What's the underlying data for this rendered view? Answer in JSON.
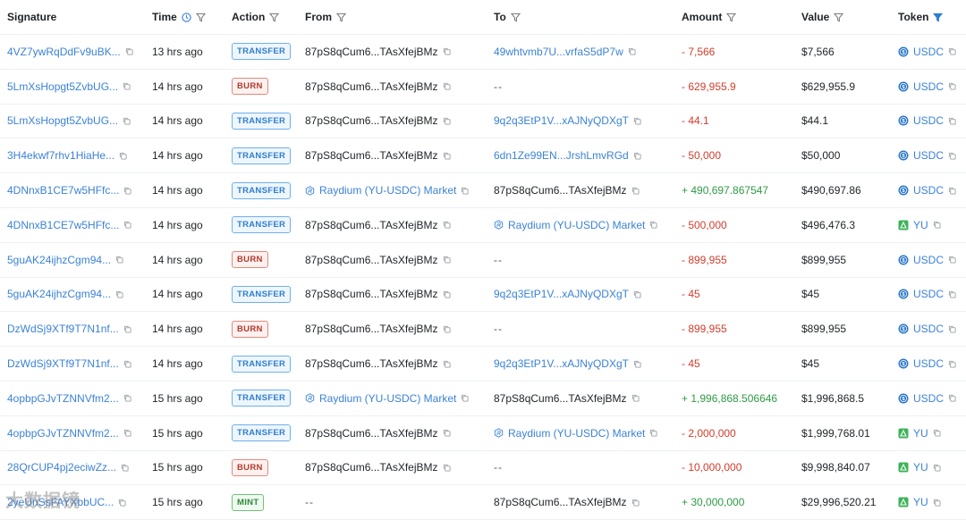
{
  "columns": {
    "signature": "Signature",
    "time": "Time",
    "action": "Action",
    "from": "From",
    "to": "To",
    "amount": "Amount",
    "value": "Value",
    "token": "Token"
  },
  "colors": {
    "link": "#3b82d6",
    "negative": "#d23c2c",
    "positive": "#2f9a44",
    "filter_active": "#2e7fd0"
  },
  "rows": [
    {
      "signature": "4VZ7ywRqDdFv9uBK...",
      "time": "13 hrs ago",
      "action": "TRANSFER",
      "action_type": "transfer",
      "from": "87pS8qCum6...TAsXfejBMz",
      "from_link": false,
      "from_pool": false,
      "to": "49whtvmb7U...vrfaS5dP7w",
      "to_link": true,
      "to_pool": false,
      "amount": "- 7,566",
      "amount_sign": "neg",
      "value": "$7,566",
      "token": "USDC",
      "token_type": "usdc"
    },
    {
      "signature": "5LmXsHopgt5ZvbUG...",
      "time": "14 hrs ago",
      "action": "BURN",
      "action_type": "burn",
      "from": "87pS8qCum6...TAsXfejBMz",
      "from_link": false,
      "from_pool": false,
      "to": "--",
      "to_link": false,
      "to_pool": false,
      "amount": "- 629,955.9",
      "amount_sign": "neg",
      "value": "$629,955.9",
      "token": "USDC",
      "token_type": "usdc"
    },
    {
      "signature": "5LmXsHopgt5ZvbUG...",
      "time": "14 hrs ago",
      "action": "TRANSFER",
      "action_type": "transfer",
      "from": "87pS8qCum6...TAsXfejBMz",
      "from_link": false,
      "from_pool": false,
      "to": "9q2q3EtP1V...xAJNyQDXgT",
      "to_link": true,
      "to_pool": false,
      "amount": "- 44.1",
      "amount_sign": "neg",
      "value": "$44.1",
      "token": "USDC",
      "token_type": "usdc"
    },
    {
      "signature": "3H4ekwf7rhv1HiaHe...",
      "time": "14 hrs ago",
      "action": "TRANSFER",
      "action_type": "transfer",
      "from": "87pS8qCum6...TAsXfejBMz",
      "from_link": false,
      "from_pool": false,
      "to": "6dn1Ze99EN...JrshLmvRGd",
      "to_link": true,
      "to_pool": false,
      "amount": "- 50,000",
      "amount_sign": "neg",
      "value": "$50,000",
      "token": "USDC",
      "token_type": "usdc"
    },
    {
      "signature": "4DNnxB1CE7w5HFfc...",
      "time": "14 hrs ago",
      "action": "TRANSFER",
      "action_type": "transfer",
      "from": "Raydium (YU-USDC) Market",
      "from_link": true,
      "from_pool": true,
      "to": "87pS8qCum6...TAsXfejBMz",
      "to_link": false,
      "to_pool": false,
      "amount": "+ 490,697.867547",
      "amount_sign": "pos",
      "value": "$490,697.86",
      "token": "USDC",
      "token_type": "usdc"
    },
    {
      "signature": "4DNnxB1CE7w5HFfc...",
      "time": "14 hrs ago",
      "action": "TRANSFER",
      "action_type": "transfer",
      "from": "87pS8qCum6...TAsXfejBMz",
      "from_link": false,
      "from_pool": false,
      "to": "Raydium (YU-USDC) Market",
      "to_link": true,
      "to_pool": true,
      "amount": "- 500,000",
      "amount_sign": "neg",
      "value": "$496,476.3",
      "token": "YU",
      "token_type": "yu"
    },
    {
      "signature": "5guAK24ijhzCgm94...",
      "time": "14 hrs ago",
      "action": "BURN",
      "action_type": "burn",
      "from": "87pS8qCum6...TAsXfejBMz",
      "from_link": false,
      "from_pool": false,
      "to": "--",
      "to_link": false,
      "to_pool": false,
      "amount": "- 899,955",
      "amount_sign": "neg",
      "value": "$899,955",
      "token": "USDC",
      "token_type": "usdc"
    },
    {
      "signature": "5guAK24ijhzCgm94...",
      "time": "14 hrs ago",
      "action": "TRANSFER",
      "action_type": "transfer",
      "from": "87pS8qCum6...TAsXfejBMz",
      "from_link": false,
      "from_pool": false,
      "to": "9q2q3EtP1V...xAJNyQDXgT",
      "to_link": true,
      "to_pool": false,
      "amount": "- 45",
      "amount_sign": "neg",
      "value": "$45",
      "token": "USDC",
      "token_type": "usdc"
    },
    {
      "signature": "DzWdSj9XTf9T7N1nf...",
      "time": "14 hrs ago",
      "action": "BURN",
      "action_type": "burn",
      "from": "87pS8qCum6...TAsXfejBMz",
      "from_link": false,
      "from_pool": false,
      "to": "--",
      "to_link": false,
      "to_pool": false,
      "amount": "- 899,955",
      "amount_sign": "neg",
      "value": "$899,955",
      "token": "USDC",
      "token_type": "usdc"
    },
    {
      "signature": "DzWdSj9XTf9T7N1nf...",
      "time": "14 hrs ago",
      "action": "TRANSFER",
      "action_type": "transfer",
      "from": "87pS8qCum6...TAsXfejBMz",
      "from_link": false,
      "from_pool": false,
      "to": "9q2q3EtP1V...xAJNyQDXgT",
      "to_link": true,
      "to_pool": false,
      "amount": "- 45",
      "amount_sign": "neg",
      "value": "$45",
      "token": "USDC",
      "token_type": "usdc"
    },
    {
      "signature": "4opbpGJvTZNNVfm2...",
      "time": "15 hrs ago",
      "action": "TRANSFER",
      "action_type": "transfer",
      "from": "Raydium (YU-USDC) Market",
      "from_link": true,
      "from_pool": true,
      "to": "87pS8qCum6...TAsXfejBMz",
      "to_link": false,
      "to_pool": false,
      "amount": "+ 1,996,868.506646",
      "amount_sign": "pos",
      "value": "$1,996,868.5",
      "token": "USDC",
      "token_type": "usdc"
    },
    {
      "signature": "4opbpGJvTZNNVfm2...",
      "time": "15 hrs ago",
      "action": "TRANSFER",
      "action_type": "transfer",
      "from": "87pS8qCum6...TAsXfejBMz",
      "from_link": false,
      "from_pool": false,
      "to": "Raydium (YU-USDC) Market",
      "to_link": true,
      "to_pool": true,
      "amount": "- 2,000,000",
      "amount_sign": "neg",
      "value": "$1,999,768.01",
      "token": "YU",
      "token_type": "yu"
    },
    {
      "signature": "28QrCUP4pj2eciwZz...",
      "time": "15 hrs ago",
      "action": "BURN",
      "action_type": "burn",
      "from": "87pS8qCum6...TAsXfejBMz",
      "from_link": false,
      "from_pool": false,
      "to": "--",
      "to_link": false,
      "to_pool": false,
      "amount": "- 10,000,000",
      "amount_sign": "neg",
      "value": "$9,998,840.07",
      "token": "YU",
      "token_type": "yu"
    },
    {
      "signature": "2yeUnSsFAYXbbUC...",
      "time": "15 hrs ago",
      "action": "MINT",
      "action_type": "mint",
      "from": "--",
      "from_link": false,
      "from_pool": false,
      "to": "87pS8qCum6...TAsXfejBMz",
      "to_link": false,
      "to_pool": false,
      "amount": "+ 30,000,000",
      "amount_sign": "pos",
      "value": "$29,996,520.21",
      "token": "YU",
      "token_type": "yu"
    }
  ],
  "watermark": "大数据镜"
}
